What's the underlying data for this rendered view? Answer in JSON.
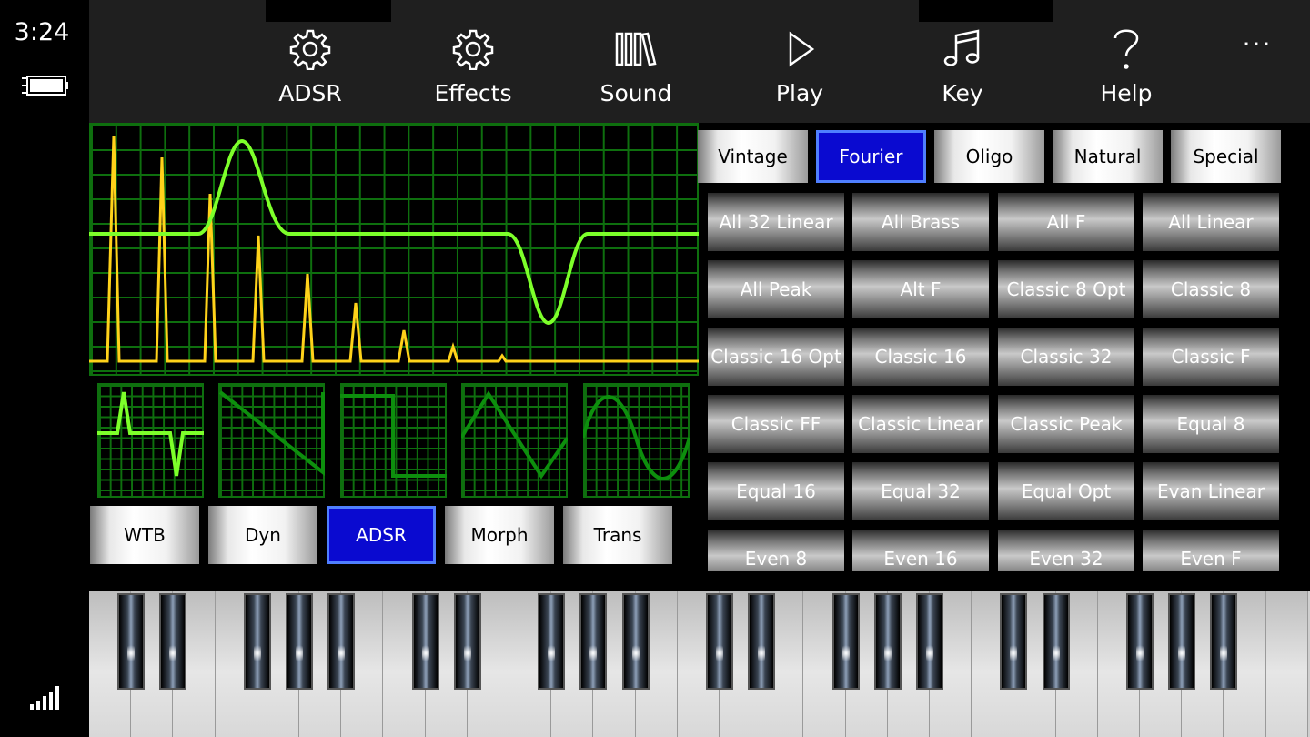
{
  "status": {
    "time": "3:24"
  },
  "appbar": {
    "buttons": [
      {
        "label": "ADSR",
        "icon": "gear-icon"
      },
      {
        "label": "Effects",
        "icon": "gear-icon"
      },
      {
        "label": "Sound",
        "icon": "library-icon"
      },
      {
        "label": "Play",
        "icon": "play-icon"
      },
      {
        "label": "Key",
        "icon": "music-note-icon"
      },
      {
        "label": "Help",
        "icon": "question-icon"
      }
    ],
    "more": "···"
  },
  "bottom_tabs": [
    {
      "label": "WTB",
      "selected": false
    },
    {
      "label": "Dyn",
      "selected": false
    },
    {
      "label": "ADSR",
      "selected": true
    },
    {
      "label": "Morph",
      "selected": false
    },
    {
      "label": "Trans",
      "selected": false
    }
  ],
  "preset_categories": [
    {
      "label": "Vintage",
      "selected": false
    },
    {
      "label": "Fourier",
      "selected": true
    },
    {
      "label": "Oligo",
      "selected": false
    },
    {
      "label": "Natural",
      "selected": false
    },
    {
      "label": "Special",
      "selected": false
    }
  ],
  "presets": [
    "All 32 Linear",
    "All Brass",
    "All F",
    "All Linear",
    "All Peak",
    "Alt F",
    "Classic 8 Opt",
    "Classic 8",
    "Classic 16 Opt",
    "Classic 16",
    "Classic 32",
    "Classic F",
    "Classic FF",
    "Classic Linear",
    "Classic Peak",
    "Equal 8",
    "Equal 16",
    "Equal 32",
    "Equal Opt",
    "Evan Linear",
    "Even 8",
    "Even 16",
    "Even 32",
    "Even F"
  ],
  "colors": {
    "grid": "#0e6f0e",
    "waveform": "#7dff2a",
    "spectrum": "#ffd21a",
    "accent_blue": "#0a0ad0"
  }
}
